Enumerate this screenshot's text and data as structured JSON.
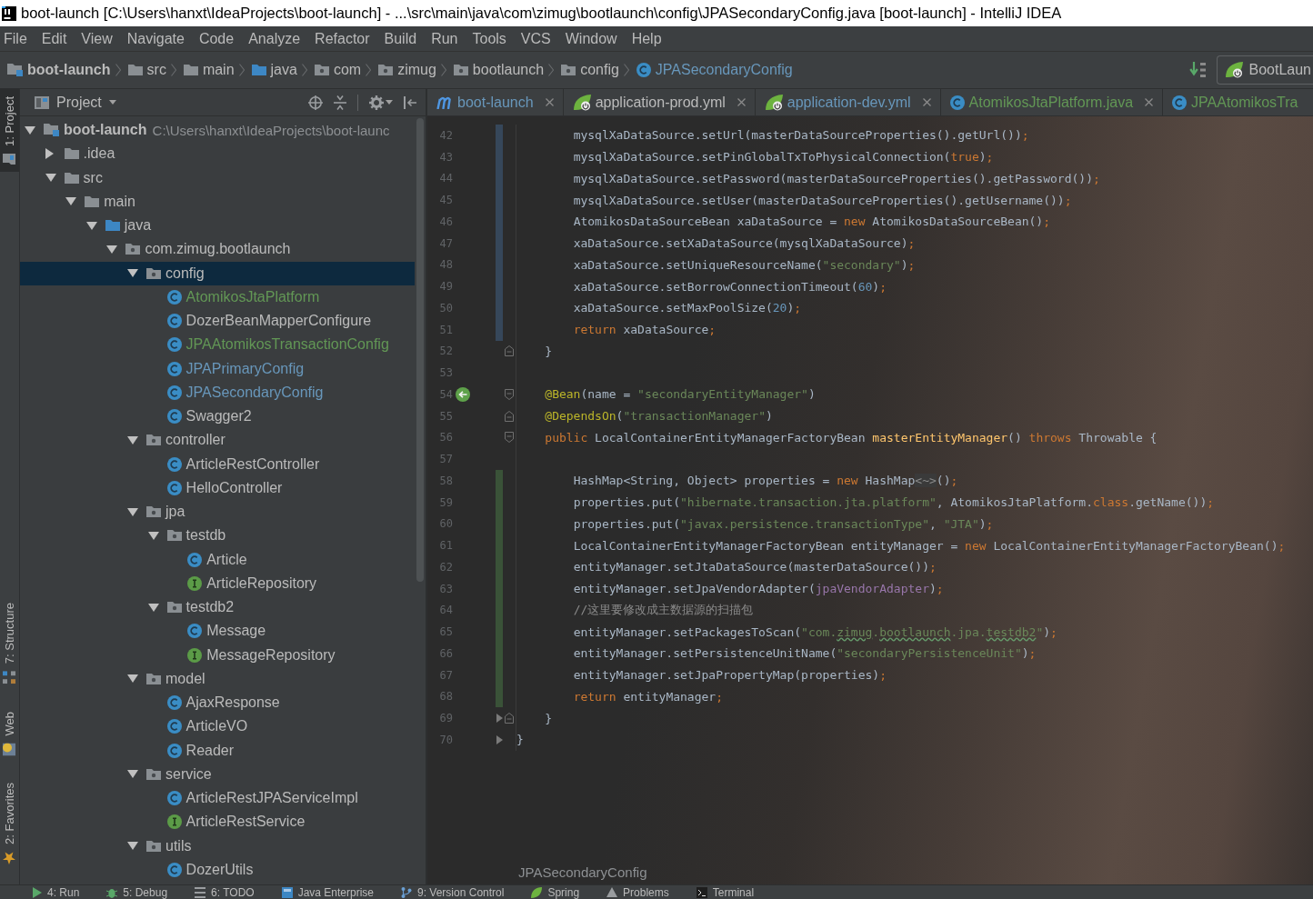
{
  "window": {
    "title": "boot-launch [C:\\Users\\hanxt\\IdeaProjects\\boot-launch] - ...\\src\\main\\java\\com\\zimug\\bootlaunch\\config\\JPASecondaryConfig.java [boot-launch] - IntelliJ IDEA"
  },
  "menu": [
    "File",
    "Edit",
    "View",
    "Navigate",
    "Code",
    "Analyze",
    "Refactor",
    "Build",
    "Run",
    "Tools",
    "VCS",
    "Window",
    "Help"
  ],
  "navigation_bar": {
    "breadcrumbs": [
      {
        "label": "boot-launch",
        "kind": "project"
      },
      {
        "label": "src",
        "kind": "folder"
      },
      {
        "label": "main",
        "kind": "folder"
      },
      {
        "label": "java",
        "kind": "source-folder"
      },
      {
        "label": "com",
        "kind": "package"
      },
      {
        "label": "zimug",
        "kind": "package"
      },
      {
        "label": "bootlaunch",
        "kind": "package"
      },
      {
        "label": "config",
        "kind": "package"
      },
      {
        "label": "JPASecondaryConfig",
        "kind": "class",
        "color": "#6897bb"
      }
    ],
    "run_configuration": {
      "label": "BootLaun"
    }
  },
  "tool_strip": {
    "top": [
      {
        "label": "1: Project",
        "kind": "project",
        "selected": true
      }
    ],
    "bottom": [
      {
        "label": "7: Structure",
        "kind": "structure",
        "selected": false
      },
      {
        "label": "Web",
        "kind": "web",
        "selected": false
      },
      {
        "label": "2: Favorites",
        "kind": "favorites",
        "selected": false
      }
    ]
  },
  "project_panel": {
    "title": "Project",
    "tree": [
      {
        "label": "boot-launch",
        "kind": "project",
        "path": "C:\\Users\\hanxt\\IdeaProjects\\boot-launc",
        "selected": false,
        "expanded": true,
        "children": [
          {
            "label": ".idea",
            "kind": "folder",
            "selected": false,
            "expanded": false
          },
          {
            "label": "src",
            "kind": "folder",
            "selected": false,
            "expanded": true,
            "children": [
              {
                "label": "main",
                "kind": "folder",
                "selected": false,
                "expanded": true,
                "children": [
                  {
                    "label": "java",
                    "kind": "source-folder",
                    "selected": false,
                    "expanded": true,
                    "children": [
                      {
                        "label": "com.zimug.bootlaunch",
                        "kind": "package",
                        "selected": false,
                        "expanded": true,
                        "children": [
                          {
                            "label": "config",
                            "kind": "package",
                            "selected": true,
                            "expanded": true,
                            "children": [
                              {
                                "label": "AtomikosJtaPlatform",
                                "kind": "class",
                                "color": "#629755",
                                "selected": false
                              },
                              {
                                "label": "DozerBeanMapperConfigure",
                                "kind": "class",
                                "selected": false
                              },
                              {
                                "label": "JPAAtomikosTransactionConfig",
                                "kind": "class",
                                "color": "#629755",
                                "selected": false
                              },
                              {
                                "label": "JPAPrimaryConfig",
                                "kind": "class",
                                "color": "#6897bb",
                                "selected": false
                              },
                              {
                                "label": "JPASecondaryConfig",
                                "kind": "class",
                                "color": "#6897bb",
                                "selected": false
                              },
                              {
                                "label": "Swagger2",
                                "kind": "class",
                                "selected": false
                              }
                            ]
                          },
                          {
                            "label": "controller",
                            "kind": "package",
                            "selected": false,
                            "expanded": true,
                            "children": [
                              {
                                "label": "ArticleRestController",
                                "kind": "class",
                                "selected": false
                              },
                              {
                                "label": "HelloController",
                                "kind": "class",
                                "selected": false
                              }
                            ]
                          },
                          {
                            "label": "jpa",
                            "kind": "package",
                            "selected": false,
                            "expanded": true,
                            "children": [
                              {
                                "label": "testdb",
                                "kind": "package",
                                "selected": false,
                                "expanded": true,
                                "children": [
                                  {
                                    "label": "Article",
                                    "kind": "class",
                                    "selected": false
                                  },
                                  {
                                    "label": "ArticleRepository",
                                    "kind": "interface",
                                    "selected": false
                                  }
                                ]
                              },
                              {
                                "label": "testdb2",
                                "kind": "package",
                                "selected": false,
                                "expanded": true,
                                "children": [
                                  {
                                    "label": "Message",
                                    "kind": "class",
                                    "selected": false
                                  },
                                  {
                                    "label": "MessageRepository",
                                    "kind": "interface",
                                    "selected": false
                                  }
                                ]
                              }
                            ]
                          },
                          {
                            "label": "model",
                            "kind": "package",
                            "selected": false,
                            "expanded": true,
                            "children": [
                              {
                                "label": "AjaxResponse",
                                "kind": "class",
                                "selected": false
                              },
                              {
                                "label": "ArticleVO",
                                "kind": "class",
                                "selected": false
                              },
                              {
                                "label": "Reader",
                                "kind": "class",
                                "selected": false
                              }
                            ]
                          },
                          {
                            "label": "service",
                            "kind": "package",
                            "selected": false,
                            "expanded": true,
                            "children": [
                              {
                                "label": "ArticleRestJPAServiceImpl",
                                "kind": "class",
                                "selected": false
                              },
                              {
                                "label": "ArticleRestService",
                                "kind": "interface",
                                "selected": false
                              }
                            ]
                          },
                          {
                            "label": "utils",
                            "kind": "package",
                            "selected": false,
                            "expanded": true,
                            "children": [
                              {
                                "label": "DozerUtils",
                                "kind": "class",
                                "selected": false
                              }
                            ]
                          }
                        ]
                      }
                    ]
                  }
                ]
              }
            ]
          }
        ]
      }
    ]
  },
  "editor": {
    "background_photo": true,
    "tabs": [
      {
        "label": "boot-launch",
        "kind": "maven",
        "color": "#6897bb",
        "selected": false,
        "closable": true
      },
      {
        "label": "application-prod.yml",
        "kind": "spring",
        "selected": false,
        "closable": true
      },
      {
        "label": "application-dev.yml",
        "kind": "spring",
        "color": "#6897bb",
        "selected": false,
        "closable": true
      },
      {
        "label": "AtomikosJtaPlatform.java",
        "kind": "class",
        "color": "#629755",
        "selected": false,
        "closable": true
      },
      {
        "label": "JPAAtomikosTra",
        "kind": "class",
        "color": "#629755",
        "selected": false,
        "closable": false
      }
    ],
    "lines": [
      {
        "number": "42",
        "change_marker": {
          "color": "#36475a"
        },
        "tokens": [
          {
            "kind": "plain",
            "text": "        mysqlXaDataSource.setUrl(masterDataSourceProperties().getUrl())"
          },
          {
            "kind": "punct",
            "text": ";"
          }
        ]
      },
      {
        "number": "43",
        "change_marker": {
          "color": "#36475a"
        },
        "tokens": [
          {
            "kind": "plain",
            "text": "        mysqlXaDataSource.setPinGlobalTxToPhysicalConnection("
          },
          {
            "kind": "keyword",
            "text": "true"
          },
          {
            "kind": "plain",
            "text": ")"
          },
          {
            "kind": "punct",
            "text": ";"
          }
        ]
      },
      {
        "number": "44",
        "change_marker": {
          "color": "#36475a"
        },
        "tokens": [
          {
            "kind": "plain",
            "text": "        mysqlXaDataSource.setPassword(masterDataSourceProperties().getPassword())"
          },
          {
            "kind": "punct",
            "text": ";"
          }
        ]
      },
      {
        "number": "45",
        "change_marker": {
          "color": "#36475a"
        },
        "tokens": [
          {
            "kind": "plain",
            "text": "        mysqlXaDataSource.setUser(masterDataSourceProperties().getUsername())"
          },
          {
            "kind": "punct",
            "text": ";"
          }
        ]
      },
      {
        "number": "46",
        "change_marker": {
          "color": "#36475a"
        },
        "tokens": [
          {
            "kind": "plain",
            "text": "        AtomikosDataSourceBean xaDataSource = "
          },
          {
            "kind": "keyword",
            "text": "new"
          },
          {
            "kind": "plain",
            "text": " AtomikosDataSourceBean()"
          },
          {
            "kind": "punct",
            "text": ";"
          }
        ]
      },
      {
        "number": "47",
        "change_marker": {
          "color": "#36475a"
        },
        "tokens": [
          {
            "kind": "plain",
            "text": "        xaDataSource.setXaDataSource(mysqlXaDataSource)"
          },
          {
            "kind": "punct",
            "text": ";"
          }
        ]
      },
      {
        "number": "48",
        "change_marker": {
          "color": "#36475a"
        },
        "tokens": [
          {
            "kind": "plain",
            "text": "        xaDataSource.setUniqueResourceName("
          },
          {
            "kind": "string",
            "text": "\"secondary\""
          },
          {
            "kind": "plain",
            "text": ")"
          },
          {
            "kind": "punct",
            "text": ";"
          }
        ]
      },
      {
        "number": "49",
        "change_marker": {
          "color": "#36475a"
        },
        "tokens": [
          {
            "kind": "plain",
            "text": "        xaDataSource.setBorrowConnectionTimeout("
          },
          {
            "kind": "number",
            "text": "60"
          },
          {
            "kind": "plain",
            "text": ")"
          },
          {
            "kind": "punct",
            "text": ";"
          }
        ]
      },
      {
        "number": "50",
        "change_marker": {
          "color": "#36475a"
        },
        "tokens": [
          {
            "kind": "plain",
            "text": "        xaDataSource.setMaxPoolSize("
          },
          {
            "kind": "number",
            "text": "20"
          },
          {
            "kind": "plain",
            "text": ")"
          },
          {
            "kind": "punct",
            "text": ";"
          }
        ]
      },
      {
        "number": "51",
        "change_marker": {
          "color": "#36475a"
        },
        "tokens": [
          {
            "kind": "keyword",
            "text": "        return"
          },
          {
            "kind": "plain",
            "text": " xaDataSource"
          },
          {
            "kind": "punct",
            "text": ";"
          }
        ]
      },
      {
        "number": "52",
        "gutter_marks": [
          {
            "kind": "fold-end"
          }
        ],
        "tokens": [
          {
            "kind": "plain",
            "text": "    }"
          }
        ]
      },
      {
        "number": "53"
      },
      {
        "number": "54",
        "gutter_marks": [
          {
            "kind": "bean"
          },
          {
            "kind": "fold-start"
          }
        ],
        "tokens": [
          {
            "kind": "annotation",
            "text": "    @Bean"
          },
          {
            "kind": "plain",
            "text": "(name = "
          },
          {
            "kind": "string",
            "text": "\"secondaryEntityManager\""
          },
          {
            "kind": "plain",
            "text": ")"
          }
        ]
      },
      {
        "number": "55",
        "gutter_marks": [
          {
            "kind": "fold-end"
          }
        ],
        "tokens": [
          {
            "kind": "annotation",
            "text": "    @DependsOn"
          },
          {
            "kind": "plain",
            "text": "("
          },
          {
            "kind": "string",
            "text": "\"transactionManager\""
          },
          {
            "kind": "plain",
            "text": ")"
          }
        ]
      },
      {
        "number": "56",
        "gutter_marks": [
          {
            "kind": "fold-start"
          }
        ],
        "tokens": [
          {
            "kind": "keyword",
            "text": "    public"
          },
          {
            "kind": "plain",
            "text": " LocalContainerEntityManagerFactoryBean "
          },
          {
            "kind": "method",
            "text": "masterEntityManager"
          },
          {
            "kind": "plain",
            "text": "() "
          },
          {
            "kind": "keyword",
            "text": "throws"
          },
          {
            "kind": "plain",
            "text": " Throwable {"
          }
        ]
      },
      {
        "number": "57"
      },
      {
        "number": "58",
        "change_marker": {
          "color": "#3a5238"
        },
        "tokens": [
          {
            "kind": "plain",
            "text": "        HashMap<String, Object> properties = "
          },
          {
            "kind": "keyword",
            "text": "new"
          },
          {
            "kind": "plain",
            "text": " HashMap"
          },
          {
            "kind": "generic",
            "text": "<~>"
          },
          {
            "kind": "plain",
            "text": "()"
          },
          {
            "kind": "punct",
            "text": ";"
          }
        ]
      },
      {
        "number": "59",
        "change_marker": {
          "color": "#3a5238"
        },
        "tokens": [
          {
            "kind": "plain",
            "text": "        properties.put("
          },
          {
            "kind": "string",
            "text": "\"hibernate.transaction.jta.platform\""
          },
          {
            "kind": "plain",
            "text": ", AtomikosJtaPlatform."
          },
          {
            "kind": "keyword",
            "text": "class"
          },
          {
            "kind": "plain",
            "text": ".getName())"
          },
          {
            "kind": "punct",
            "text": ";"
          }
        ]
      },
      {
        "number": "60",
        "change_marker": {
          "color": "#3a5238"
        },
        "tokens": [
          {
            "kind": "plain",
            "text": "        properties.put("
          },
          {
            "kind": "string",
            "text": "\"javax.persistence.transactionType\""
          },
          {
            "kind": "plain",
            "text": ", "
          },
          {
            "kind": "string",
            "text": "\"JTA\""
          },
          {
            "kind": "plain",
            "text": ")"
          },
          {
            "kind": "punct",
            "text": ";"
          }
        ]
      },
      {
        "number": "61",
        "change_marker": {
          "color": "#3a5238"
        },
        "tokens": [
          {
            "kind": "plain",
            "text": "        LocalContainerEntityManagerFactoryBean entityManager = "
          },
          {
            "kind": "keyword",
            "text": "new"
          },
          {
            "kind": "plain",
            "text": " LocalContainerEntityManagerFactoryBean()"
          },
          {
            "kind": "punct",
            "text": ";"
          }
        ]
      },
      {
        "number": "62",
        "change_marker": {
          "color": "#3a5238"
        },
        "tokens": [
          {
            "kind": "plain",
            "text": "        entityManager.setJtaDataSource(masterDataSource())"
          },
          {
            "kind": "punct",
            "text": ";"
          }
        ]
      },
      {
        "number": "63",
        "change_marker": {
          "color": "#3a5238"
        },
        "tokens": [
          {
            "kind": "plain",
            "text": "        entityManager.setJpaVendorAdapter("
          },
          {
            "kind": "field",
            "text": "jpaVendorAdapter"
          },
          {
            "kind": "plain",
            "text": ")"
          },
          {
            "kind": "punct",
            "text": ";"
          }
        ]
      },
      {
        "number": "64",
        "change_marker": {
          "color": "#3a5238"
        },
        "tokens": [
          {
            "kind": "comment",
            "text": "        //这里要修改成主数据源的扫描包"
          }
        ]
      },
      {
        "number": "65",
        "change_marker": {
          "color": "#3a5238"
        },
        "tokens": [
          {
            "kind": "plain",
            "text": "        entityManager.setPackagesToScan("
          },
          {
            "kind": "string",
            "text": "\"com."
          },
          {
            "kind": "typo",
            "text": "zimug"
          },
          {
            "kind": "string",
            "text": "."
          },
          {
            "kind": "typo",
            "text": "bootlaunch"
          },
          {
            "kind": "string",
            "text": ".jpa."
          },
          {
            "kind": "typo",
            "text": "testdb2"
          },
          {
            "kind": "string",
            "text": "\""
          },
          {
            "kind": "plain",
            "text": ")"
          },
          {
            "kind": "punct",
            "text": ";"
          }
        ]
      },
      {
        "number": "66",
        "change_marker": {
          "color": "#3a5238"
        },
        "tokens": [
          {
            "kind": "plain",
            "text": "        entityManager.setPersistenceUnitName("
          },
          {
            "kind": "string",
            "text": "\"secondaryPersistenceUnit\""
          },
          {
            "kind": "plain",
            "text": ")"
          },
          {
            "kind": "punct",
            "text": ";"
          }
        ]
      },
      {
        "number": "67",
        "change_marker": {
          "color": "#3a5238"
        },
        "tokens": [
          {
            "kind": "plain",
            "text": "        entityManager.setJpaPropertyMap(properties)"
          },
          {
            "kind": "punct",
            "text": ";"
          }
        ]
      },
      {
        "number": "68",
        "change_marker": {
          "color": "#3a5238"
        },
        "tokens": [
          {
            "kind": "keyword",
            "text": "        return"
          },
          {
            "kind": "plain",
            "text": " entityManager"
          },
          {
            "kind": "punct",
            "text": ";"
          }
        ]
      },
      {
        "number": "69",
        "gutter_marks": [
          {
            "kind": "fold-end"
          },
          {
            "kind": "arrow"
          }
        ],
        "tokens": [
          {
            "kind": "plain",
            "text": "    }"
          }
        ]
      },
      {
        "number": "70",
        "gutter_marks": [
          {
            "kind": "arrow"
          }
        ],
        "tokens": [
          {
            "kind": "plain",
            "text": "}"
          }
        ]
      }
    ],
    "breadcrumb": "JPASecondaryConfig"
  },
  "bottom_tool_bar": [
    {
      "label": "4: Run",
      "kind": "run",
      "selected": false
    },
    {
      "label": "5: Debug",
      "kind": "debug",
      "selected": false
    },
    {
      "label": "6: TODO",
      "kind": "todo",
      "selected": false
    },
    {
      "label": "Java Enterprise",
      "kind": "enterprise",
      "selected": false
    },
    {
      "label": "9: Version Control",
      "kind": "vcs",
      "selected": false
    },
    {
      "label": "Spring",
      "kind": "spring",
      "selected": false
    },
    {
      "label": "Problems",
      "kind": "problems",
      "selected": false
    },
    {
      "label": "Terminal",
      "kind": "terminal",
      "selected": false
    }
  ]
}
